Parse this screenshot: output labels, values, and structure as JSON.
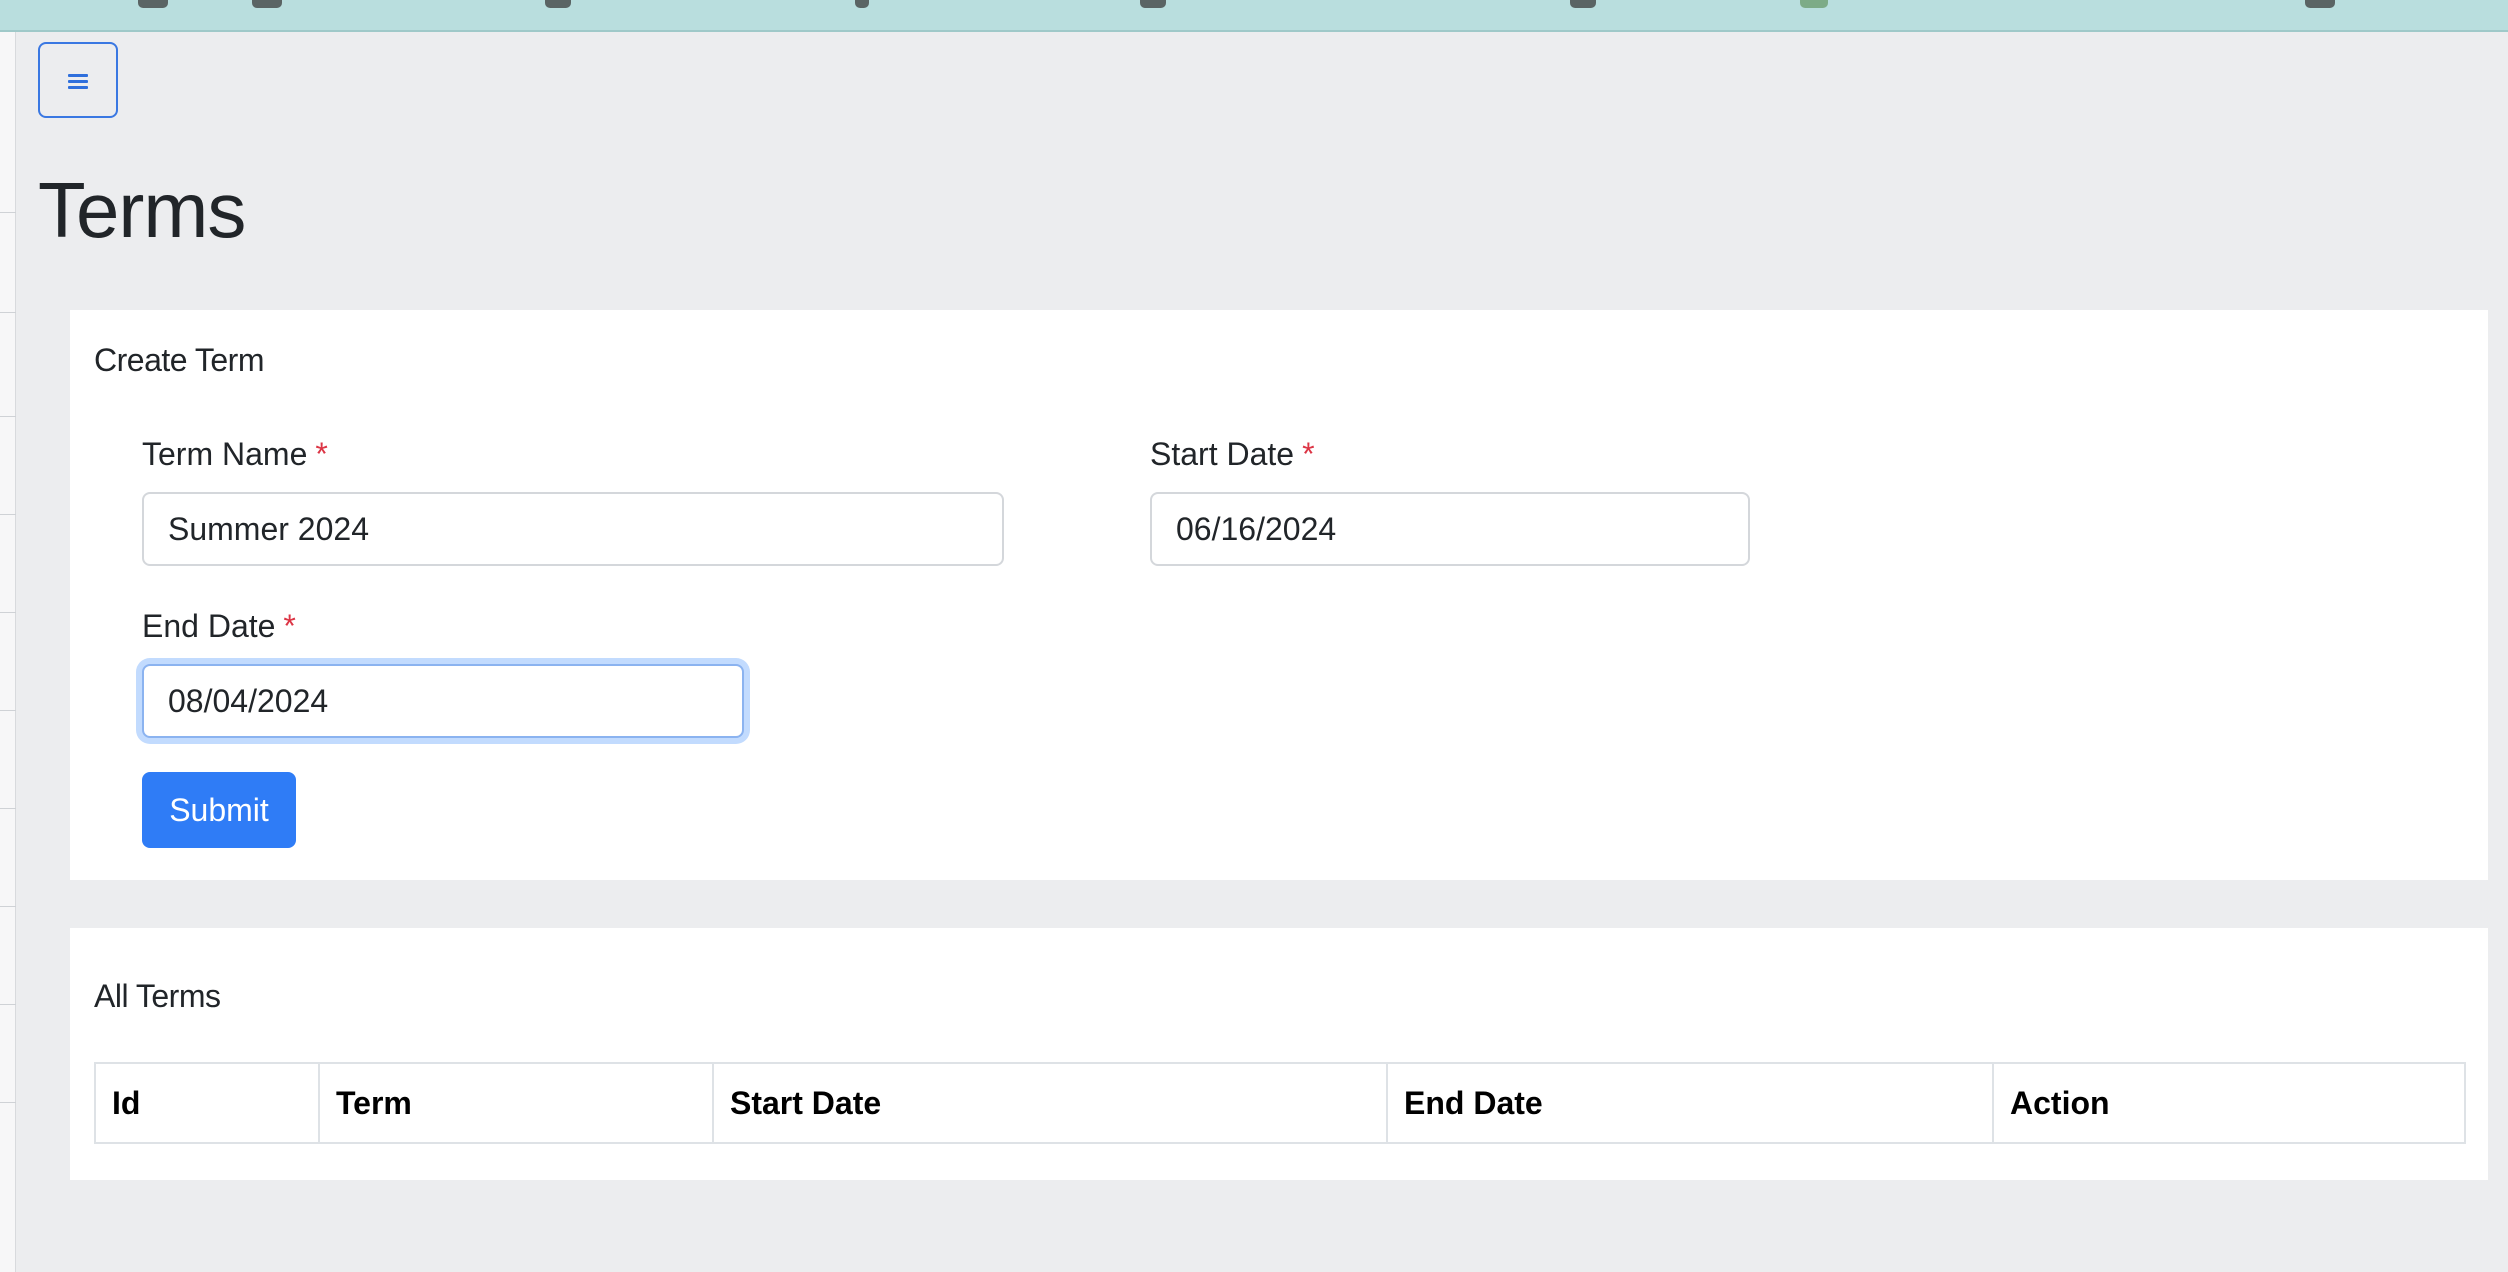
{
  "menu": {
    "icon": "hamburger-menu-icon"
  },
  "page": {
    "title": "Terms"
  },
  "create_card": {
    "title": "Create Term",
    "required_marker": "*",
    "term_name": {
      "label": "Term Name",
      "value": "Summer 2024"
    },
    "start_date": {
      "label": "Start Date",
      "value": "06/16/2024"
    },
    "end_date": {
      "label": "End Date",
      "value": "08/04/2024"
    },
    "submit_label": "Submit"
  },
  "list_card": {
    "title": "All Terms",
    "columns": [
      "Id",
      "Term",
      "Start Date",
      "End Date",
      "Action"
    ],
    "rows": []
  },
  "colors": {
    "accent": "#2f7cf6",
    "required": "#dc3545",
    "page_background": "#ecedef",
    "top_strip": "#b9dede"
  }
}
